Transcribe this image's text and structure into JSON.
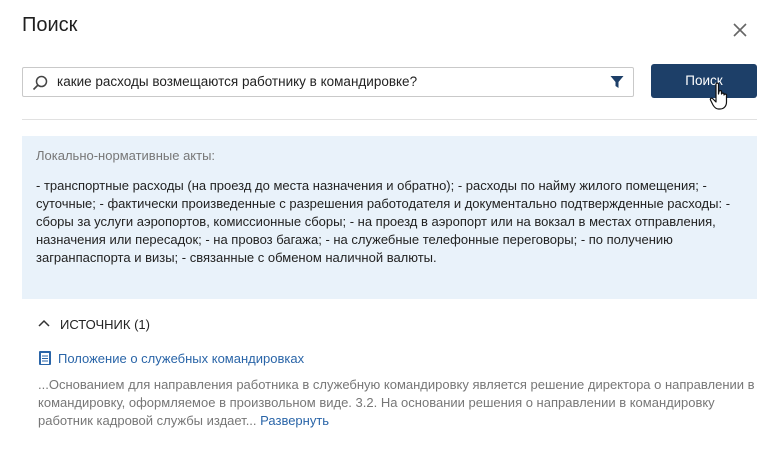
{
  "dialog": {
    "title": "Поиск"
  },
  "search": {
    "query": "какие расходы возмещаются работнику в командировке?",
    "button_label": "Поиск"
  },
  "answer": {
    "label": "Локально-нормативные акты:",
    "text": "- транспортные расходы (на проезд до места назначения и обратно); - расходы по найму жилого помещения; - суточные; - фактически произведенные с разрешения работодателя и документально подтвержденные расходы: - сборы за услуги аэропортов, комиссионные сборы; - на проезд в аэропорт или на вокзал в местах отправления, назначения или пересадок; - на провоз багажа; - на служебные телефонные переговоры; - по получению загранпаспорта и визы; - связанные с обменом наличной валюты."
  },
  "sources": {
    "header": "ИСТОЧНИК (1)",
    "items": [
      {
        "title": "Положение о служебных командировках",
        "excerpt": "...Основанием для направления работника в служебную командировку является решение директора о направлении в командировку, оформляемое в произвольном виде. 3.2. На основании решения о направлении в командировку работник кадровой службы издает...",
        "expand_label": "Развернуть"
      }
    ]
  },
  "colors": {
    "primary_button": "#1d3f68",
    "link": "#2a65a8",
    "answer_bg": "#e9f2fa"
  },
  "icons": [
    "close-icon",
    "search-icon",
    "filter-icon",
    "cursor-hand-icon",
    "chevron-up-icon",
    "document-icon"
  ]
}
